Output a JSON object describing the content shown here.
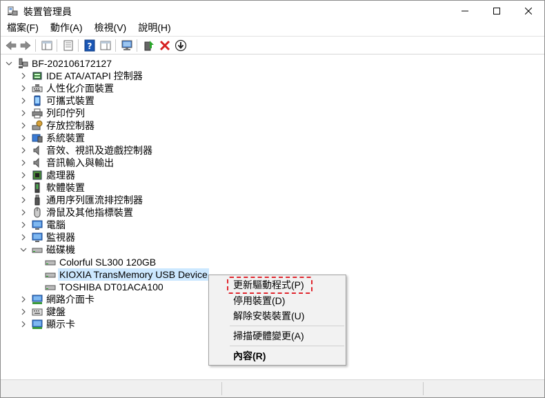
{
  "window": {
    "title": "裝置管理員",
    "controls": {
      "minimize": "minimize",
      "maximize": "maximize",
      "close": "close"
    }
  },
  "menubar": [
    {
      "label": "檔案(F)"
    },
    {
      "label": "動作(A)"
    },
    {
      "label": "檢視(V)"
    },
    {
      "label": "說明(H)"
    }
  ],
  "toolbar": {
    "icons": [
      "back-arrow-icon",
      "forward-arrow-icon",
      "show-hide-console-tree-icon",
      "properties-icon",
      "help-icon",
      "action-pane-icon",
      "scan-hardware-icon",
      "update-driver-icon",
      "uninstall-device-icon",
      "download-icon"
    ],
    "colors": {
      "uninstall": "#d62020",
      "help": "#1a56b4"
    }
  },
  "tree": {
    "root": "BF-202106172127",
    "categories": [
      {
        "label": "IDE ATA/ATAPI 控制器",
        "icon": "ide-controller-icon"
      },
      {
        "label": "人性化介面裝置",
        "icon": "hid-icon"
      },
      {
        "label": "可攜式裝置",
        "icon": "portable-device-icon"
      },
      {
        "label": "列印佇列",
        "icon": "printer-icon"
      },
      {
        "label": "存放控制器",
        "icon": "storage-controller-icon"
      },
      {
        "label": "系統裝置",
        "icon": "system-device-icon"
      },
      {
        "label": "音效、視訊及遊戲控制器",
        "icon": "sound-icon"
      },
      {
        "label": "音訊輸入與輸出",
        "icon": "audio-io-icon"
      },
      {
        "label": "處理器",
        "icon": "processor-icon"
      },
      {
        "label": "軟體裝置",
        "icon": "software-device-icon"
      },
      {
        "label": "通用序列匯流排控制器",
        "icon": "usb-icon"
      },
      {
        "label": "滑鼠及其他指標裝置",
        "icon": "mouse-icon"
      },
      {
        "label": "電腦",
        "icon": "computer-icon"
      },
      {
        "label": "監視器",
        "icon": "monitor-icon"
      },
      {
        "label": "磁碟機",
        "icon": "disk-drive-icon",
        "expanded": true,
        "children": [
          {
            "label": "Colorful SL300 120GB"
          },
          {
            "label": "KIOXIA TransMemory USB Device",
            "selected": true
          },
          {
            "label": "TOSHIBA DT01ACA100"
          }
        ]
      },
      {
        "label": "網路介面卡",
        "icon": "network-adapter-icon"
      },
      {
        "label": "鍵盤",
        "icon": "keyboard-icon"
      },
      {
        "label": "顯示卡",
        "icon": "display-adapter-icon"
      }
    ]
  },
  "context_menu": {
    "items": [
      {
        "label": "更新驅動程式(P)"
      },
      {
        "label": "停用裝置(D)"
      },
      {
        "label": "解除安裝裝置(U)"
      },
      {
        "label": "掃描硬體變更(A)"
      },
      {
        "label": "內容(R)",
        "bold": true
      }
    ],
    "highlight_color": "#e0242c"
  }
}
